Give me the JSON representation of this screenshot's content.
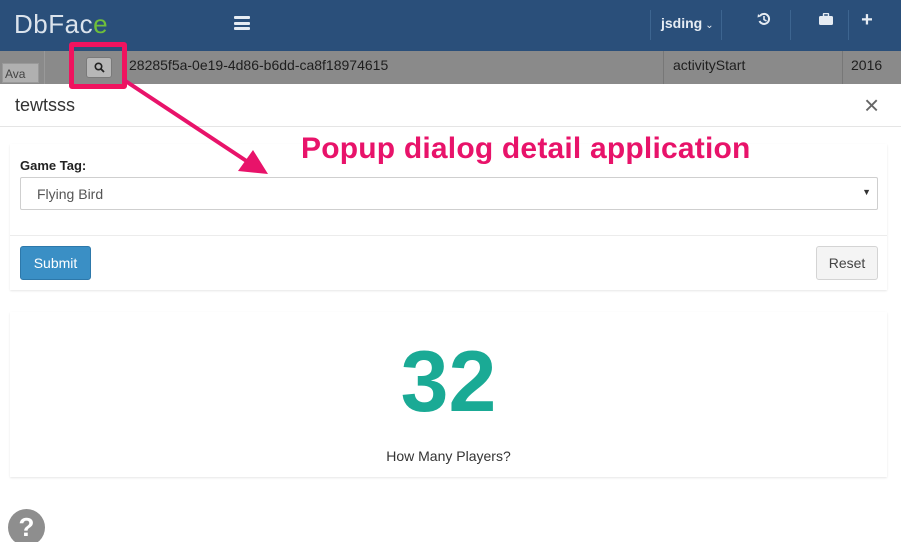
{
  "navbar": {
    "logo_main": "DbFac",
    "logo_accent": "e",
    "username": "jsding",
    "icons": [
      "history-icon",
      "briefcase-icon",
      "plus-icon"
    ]
  },
  "background_row": {
    "avatar_alt": "Ava",
    "id": "28285f5a-0e19-4d86-b6dd-ca8f18974615",
    "event": "activityStart",
    "date": "2016"
  },
  "modal": {
    "title": "tewtsss",
    "close_symbol": "×",
    "form": {
      "label": "Game Tag:",
      "selected": "Flying Bird",
      "submit_label": "Submit",
      "reset_label": "Reset"
    },
    "stat": {
      "value": "32",
      "label": "How Many Players?"
    }
  },
  "annotation": {
    "text": "Popup dialog detail application",
    "color": "#e8136a"
  },
  "help": {
    "symbol": "?"
  },
  "colors": {
    "navbar": "#2a4f7a",
    "accent_green": "#6fbf3a",
    "stat_teal": "#1aaa95",
    "submit_blue": "#3a8fc5",
    "highlight_pink": "#f0135f"
  }
}
